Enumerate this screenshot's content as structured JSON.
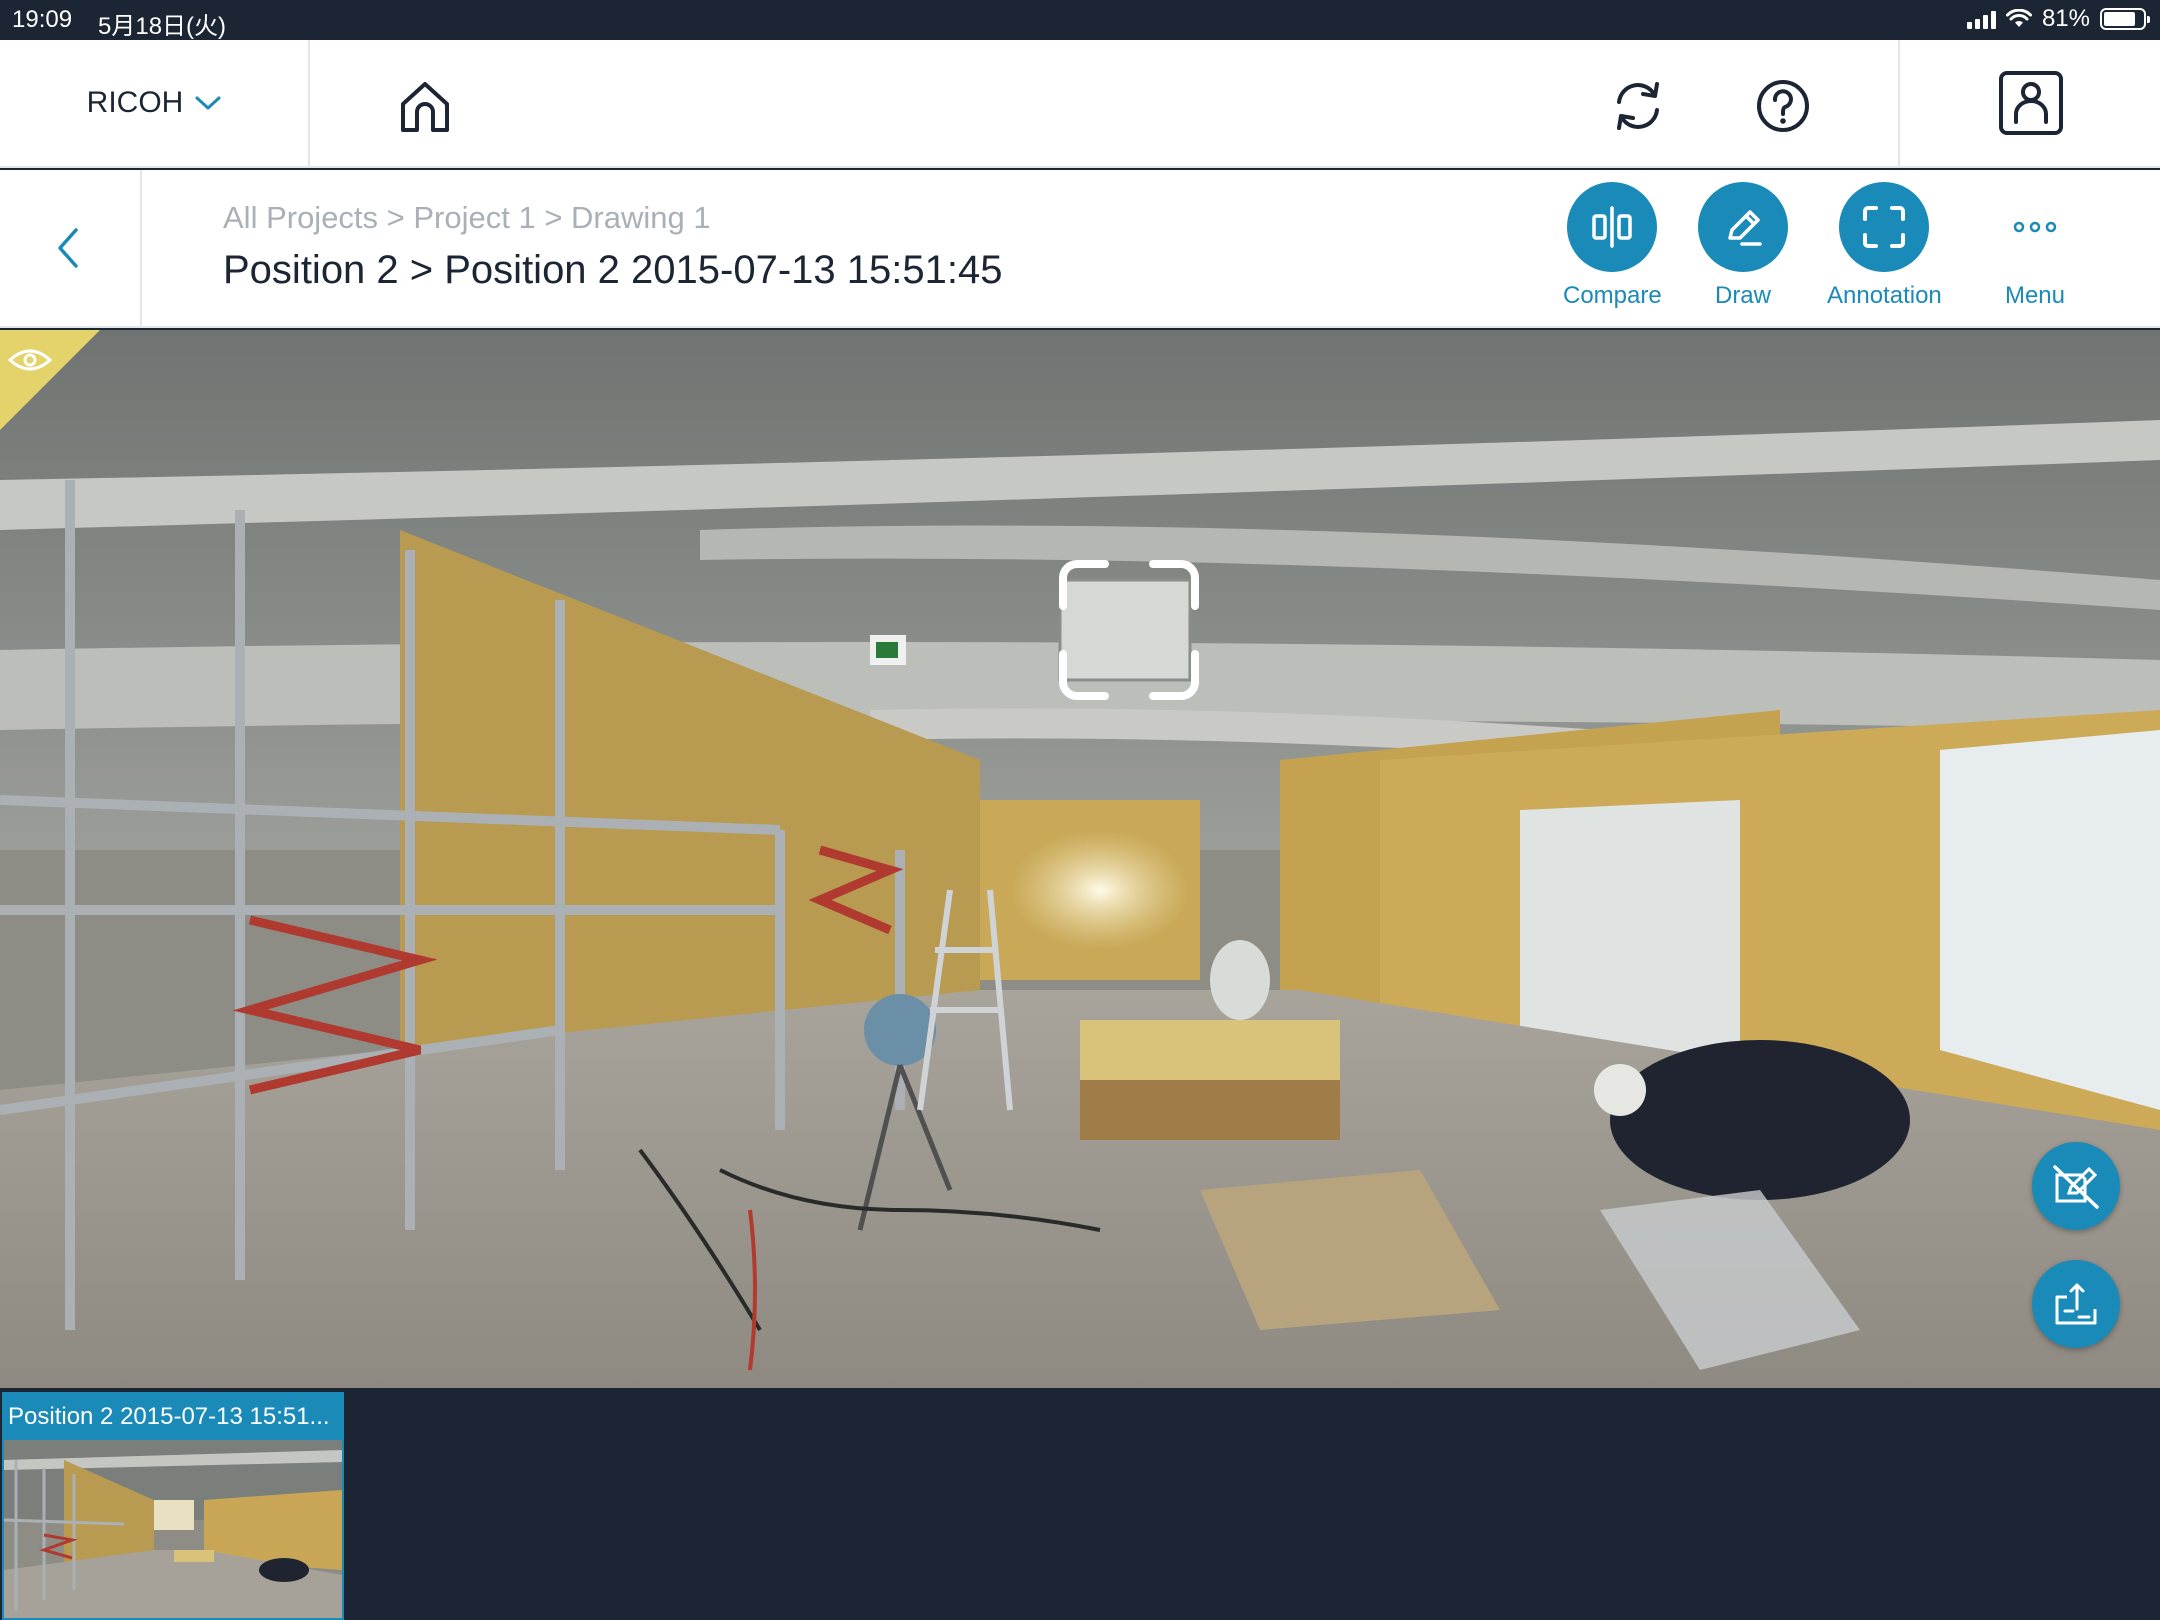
{
  "status_bar": {
    "time": "19:09",
    "date": "5月18日(火)",
    "battery": "81%",
    "battery_level": 0.81
  },
  "header": {
    "brand": "RICOH"
  },
  "subheader": {
    "breadcrumb": "All Projects > Project 1 > Drawing 1",
    "title": "Position 2 > Position 2 2015-07-13 15:51:45"
  },
  "toolbar": {
    "compare_label": "Compare",
    "draw_label": "Draw",
    "annotation_label": "Annotation",
    "menu_label": "Menu"
  },
  "thumbnails": [
    {
      "label": "Position 2 2015-07-13 15:51..."
    }
  ],
  "colors": {
    "accent": "#1a8ab8",
    "dark": "#1b2533",
    "corner_tag": "#e3d36a"
  }
}
